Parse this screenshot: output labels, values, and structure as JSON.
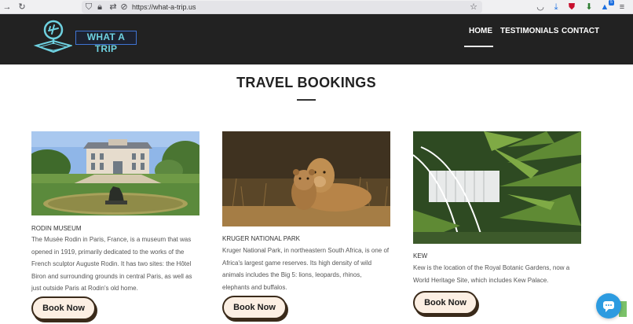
{
  "browser": {
    "url": "https://what-a-trip.us",
    "notification_count": "5"
  },
  "header": {
    "logo_text": "WHAT A TRIP",
    "nav": [
      {
        "label": "HOME"
      },
      {
        "label": "TESTIMONIALS"
      },
      {
        "label": "CONTACT"
      }
    ]
  },
  "main": {
    "title": "TRAVEL BOOKINGS",
    "cards": [
      {
        "name": "RODIN MUSEUM",
        "description": "The Musée Rodin in Paris, France, is a museum that was opened in 1919, primarily dedicated to the works of the French sculptor Auguste Rodin. It has two sites: the Hôtel Biron and surrounding grounds in central Paris, as well as just outside Paris at Rodin's old home.",
        "button": "Book Now"
      },
      {
        "name": "KRUGER NATIONAL PARK",
        "description": "Kruger National Park, in northeastern South Africa, is one of Africa's largest game reserves. Its high density of wild animals includes the Big 5: lions, leopards, rhinos, elephants and buffalos.",
        "button": "Book Now"
      },
      {
        "name": "KEW",
        "description": "Kew is the location of the Royal Botanic Gardens, now a World Heritage Site, which includes Kew Palace.",
        "button": "Book Now"
      }
    ]
  },
  "colors": {
    "header_bg": "#222222",
    "logo_accent": "#3f74d4",
    "button_bg": "#fcefe3",
    "chat_blue": "#2c9be0"
  }
}
